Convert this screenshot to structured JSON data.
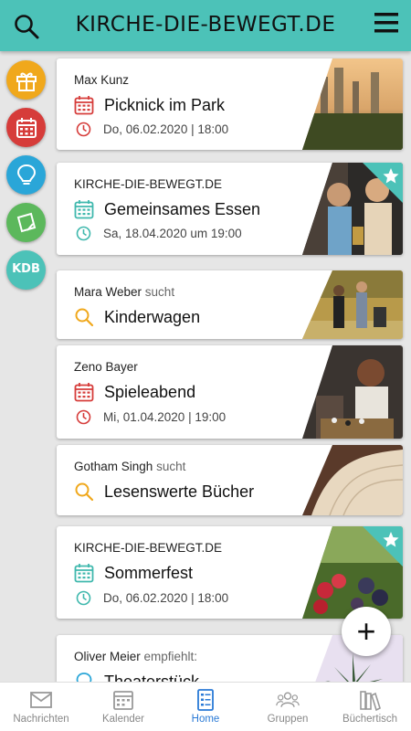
{
  "app": {
    "title": "KIRCHE-DIE-BEWEGT.DE"
  },
  "colors": {
    "accent": "#4cc2b8",
    "red": "#d63c3a",
    "teal": "#3fb8ad",
    "orange": "#f0a81c",
    "blue": "#2a7ad6"
  },
  "sidebar": {
    "kdb_label": "KDB"
  },
  "feed": [
    {
      "author": "Max Kunz",
      "verb": "",
      "icon": "calendar-icon",
      "title": "Picknick im Park",
      "date": "Do, 06.02.2020 | 18:00",
      "featured": false
    },
    {
      "author": "KIRCHE-DIE-BEWEGT.DE",
      "verb": "",
      "icon": "calendar-icon",
      "title": "Gemeinsames Essen",
      "date": "Sa, 18.04.2020 um 19:00",
      "featured": true
    },
    {
      "author": "Mara Weber",
      "verb": "sucht",
      "icon": "search-icon",
      "title": "Kinderwagen",
      "date": "",
      "featured": false
    },
    {
      "author": "Zeno Bayer",
      "verb": "",
      "icon": "calendar-icon",
      "title": "Spieleabend",
      "date": "Mi, 01.04.2020 | 19:00",
      "featured": false
    },
    {
      "author": "Gotham Singh",
      "verb": "sucht",
      "icon": "search-icon",
      "title": "Lesenswerte Bücher",
      "date": "",
      "featured": false
    },
    {
      "author": "KIRCHE-DIE-BEWEGT.DE",
      "verb": "",
      "icon": "calendar-icon",
      "title": "Sommerfest",
      "date": "Do, 06.02.2020 | 18:00",
      "featured": true
    },
    {
      "author": "Oliver Meier",
      "verb": "empfiehlt:",
      "icon": "lightbulb-icon",
      "title": "Theaterstück",
      "date": "",
      "featured": false
    }
  ],
  "fab": {
    "label": "+"
  },
  "nav": [
    {
      "label": "Nachrichten",
      "icon": "mail-icon"
    },
    {
      "label": "Kalender",
      "icon": "calendar-icon"
    },
    {
      "label": "Home",
      "icon": "home-list-icon"
    },
    {
      "label": "Gruppen",
      "icon": "group-icon"
    },
    {
      "label": "Büchertisch",
      "icon": "books-icon"
    }
  ]
}
